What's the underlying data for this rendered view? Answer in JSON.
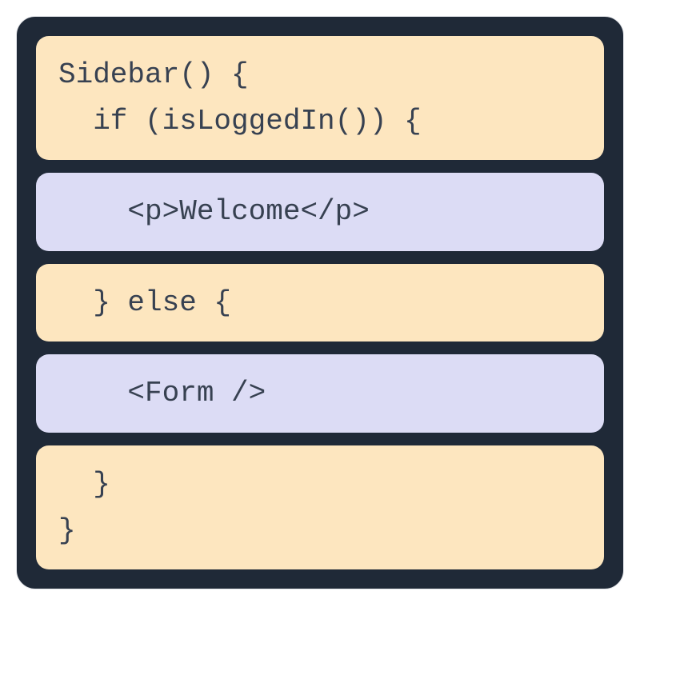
{
  "code": {
    "blocks": [
      {
        "type": "orange",
        "lines": [
          "Sidebar() {",
          "  if (isLoggedIn()) {"
        ]
      },
      {
        "type": "lavender",
        "lines": [
          "    <p>Welcome</p>"
        ]
      },
      {
        "type": "orange",
        "lines": [
          "  } else {"
        ]
      },
      {
        "type": "lavender",
        "lines": [
          "    <Form />"
        ]
      },
      {
        "type": "orange",
        "lines": [
          "  }",
          "}"
        ]
      }
    ]
  }
}
